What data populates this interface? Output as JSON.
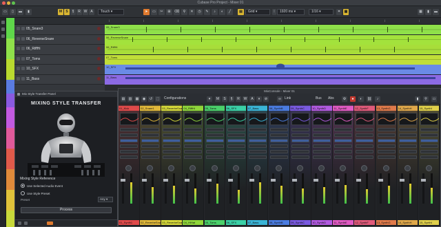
{
  "window": {
    "title": "Cubase Pro Project - Mixer 01"
  },
  "toolbar": {
    "btn_m": "M",
    "btn_s": "S",
    "glyphs": [
      "§",
      "R",
      "W",
      "A",
      "+",
      "▦"
    ],
    "touch_label": "Touch",
    "grid_label": "Grid",
    "time_label": "1920 ms",
    "quant_label": "1/16"
  },
  "colors": {
    "accent": "#d8b531",
    "record": "#c2392f"
  },
  "tracks": [
    {
      "num": "05",
      "name": "05_Snare3",
      "color": "#5fd64a"
    },
    {
      "num": "06",
      "name": "06_ReverseSnare",
      "color": "#7ed321"
    },
    {
      "num": "06",
      "name": "06_RiffHi",
      "color": "#9bd62e"
    },
    {
      "num": "07",
      "name": "07_Toms",
      "color": "#b9d92f"
    },
    {
      "num": "10",
      "name": "10_SFX",
      "color": "#4a6fd6"
    },
    {
      "num": "11",
      "name": "11_Bass",
      "color": "#7c5ad8"
    }
  ],
  "lanes": [
    {
      "label": "05_Snare3",
      "color": "#8fe04a"
    },
    {
      "label": "06_ReverseSnare",
      "color": "#a3e23c"
    },
    {
      "label": "06_RiffHi",
      "color": "#a8dd3a"
    },
    {
      "label": "07_Toms",
      "color": "#c0de38"
    },
    {
      "label": "10_SFX",
      "color": "#6a8be6"
    },
    {
      "label": "11_Bass",
      "color": "#8c6ae4"
    }
  ],
  "plugin": {
    "title": "Mix Style Transfer Panel",
    "heading": "MIXING STYLE TRANSFER",
    "ref_label": "Mixing Style Reference",
    "option1": "Use Selected Audio Event",
    "option2": "Use Style Preset",
    "preset_label": "Preset",
    "preset_value": "Any",
    "process_label": "Process"
  },
  "mixer": {
    "title": "MixConsole - Mixer 01",
    "configurations": "Configurations",
    "link": "Link",
    "btn_m": "M",
    "btn_s": "S",
    "bus": "Bus",
    "abs": "Abs",
    "channels": [
      {
        "top": "01_Kick",
        "bottom": "01_Synth1",
        "color": "#e04a4a"
      },
      {
        "top": "02_Snare1",
        "bottom": "02_ReverbeSnare",
        "color": "#e0b83a"
      },
      {
        "top": "03_ReverbeSnare",
        "bottom": "03_ReverbeSnare",
        "color": "#d6d93a"
      },
      {
        "top": "04_RiffHi",
        "bottom": "04_HiHat",
        "color": "#8fd63a"
      },
      {
        "top": "05_Toms",
        "bottom": "05_Toms",
        "color": "#4ad06a"
      },
      {
        "top": "06_SFX",
        "bottom": "06_SFX",
        "color": "#3ad0a6"
      },
      {
        "top": "07_Bass",
        "bottom": "07_Bass",
        "color": "#3ab4d6"
      },
      {
        "top": "08_SynthB",
        "bottom": "08_SynthB",
        "color": "#4a7ce0"
      },
      {
        "top": "09_SynthC",
        "bottom": "09_SynthC",
        "color": "#7a5ae0"
      },
      {
        "top": "10_SynthD",
        "bottom": "10_SynthD",
        "color": "#b25ae0"
      },
      {
        "top": "11_SynthE",
        "bottom": "11_SynthE",
        "color": "#e05ac2"
      },
      {
        "top": "12_SynthF",
        "bottom": "12_SynthF",
        "color": "#e05a7a"
      },
      {
        "top": "13_SynthG",
        "bottom": "13_SynthG",
        "color": "#e07a4a"
      },
      {
        "top": "14_SynthH",
        "bottom": "14_SynthH",
        "color": "#e0a84a"
      },
      {
        "top": "15_SynthI",
        "bottom": "15_SynthI",
        "color": "#e0d04a"
      }
    ]
  }
}
